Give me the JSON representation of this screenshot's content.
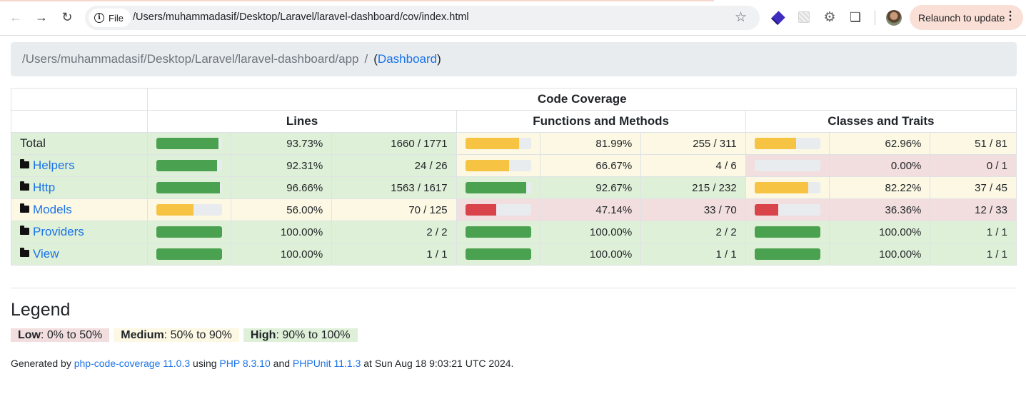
{
  "browser": {
    "chip_label": "File",
    "url": "/Users/muhammadasif/Desktop/Laravel/laravel-dashboard/cov/index.html",
    "relaunch_label": "Relaunch to update"
  },
  "breadcrumb": {
    "path": "/Users/muhammadasif/Desktop/Laravel/laravel-dashboard/app",
    "separator": "/",
    "open_paren": "(",
    "link": "Dashboard",
    "close_paren": ")"
  },
  "table": {
    "header_main": "Code Coverage",
    "headers": [
      "Lines",
      "Functions and Methods",
      "Classes and Traits"
    ],
    "rows": [
      {
        "name": "Total",
        "folder": false,
        "row_class": "success",
        "lines": {
          "pct": "93.73%",
          "ratio": "1660 / 1771",
          "value": 93.73,
          "level": "success"
        },
        "functions": {
          "pct": "81.99%",
          "ratio": "255 / 311",
          "value": 81.99,
          "level": "warning"
        },
        "classes": {
          "pct": "62.96%",
          "ratio": "51 / 81",
          "value": 62.96,
          "level": "warning"
        }
      },
      {
        "name": "Helpers",
        "folder": true,
        "row_class": "success",
        "lines": {
          "pct": "92.31%",
          "ratio": "24 / 26",
          "value": 92.31,
          "level": "success"
        },
        "functions": {
          "pct": "66.67%",
          "ratio": "4 / 6",
          "value": 66.67,
          "level": "warning"
        },
        "classes": {
          "pct": "0.00%",
          "ratio": "0 / 1",
          "value": 0,
          "level": "danger"
        }
      },
      {
        "name": "Http",
        "folder": true,
        "row_class": "success",
        "lines": {
          "pct": "96.66%",
          "ratio": "1563 / 1617",
          "value": 96.66,
          "level": "success"
        },
        "functions": {
          "pct": "92.67%",
          "ratio": "215 / 232",
          "value": 92.67,
          "level": "success"
        },
        "classes": {
          "pct": "82.22%",
          "ratio": "37 / 45",
          "value": 82.22,
          "level": "warning"
        }
      },
      {
        "name": "Models",
        "folder": true,
        "row_class": "warning",
        "lines": {
          "pct": "56.00%",
          "ratio": "70 / 125",
          "value": 56.0,
          "level": "warning"
        },
        "functions": {
          "pct": "47.14%",
          "ratio": "33 / 70",
          "value": 47.14,
          "level": "danger"
        },
        "classes": {
          "pct": "36.36%",
          "ratio": "12 / 33",
          "value": 36.36,
          "level": "danger"
        }
      },
      {
        "name": "Providers",
        "folder": true,
        "row_class": "success",
        "lines": {
          "pct": "100.00%",
          "ratio": "2 / 2",
          "value": 100,
          "level": "success"
        },
        "functions": {
          "pct": "100.00%",
          "ratio": "2 / 2",
          "value": 100,
          "level": "success"
        },
        "classes": {
          "pct": "100.00%",
          "ratio": "1 / 1",
          "value": 100,
          "level": "success"
        }
      },
      {
        "name": "View",
        "folder": true,
        "row_class": "success",
        "lines": {
          "pct": "100.00%",
          "ratio": "1 / 1",
          "value": 100,
          "level": "success"
        },
        "functions": {
          "pct": "100.00%",
          "ratio": "1 / 1",
          "value": 100,
          "level": "success"
        },
        "classes": {
          "pct": "100.00%",
          "ratio": "1 / 1",
          "value": 100,
          "level": "success"
        }
      }
    ]
  },
  "legend": {
    "title": "Legend",
    "low_label": "Low",
    "low_range": ": 0% to 50%",
    "medium_label": "Medium",
    "medium_range": ": 50% to 90%",
    "high_label": "High",
    "high_range": ": 90% to 100%"
  },
  "footer": {
    "prefix": "Generated by ",
    "tool_link": "php-code-coverage 11.0.3",
    "using": " using ",
    "php_link": "PHP 8.3.10",
    "and": " and ",
    "phpunit_link": "PHPUnit 11.1.3",
    "suffix": " at Sun Aug 18 9:03:21 UTC 2024."
  },
  "colors": {
    "success_bg": "#dff0d8",
    "warning_bg": "#fcf8e3",
    "danger_bg": "#f2dede",
    "success_bar": "#4aa150",
    "warning_bar": "#f6c342",
    "danger_bar": "#d9434a",
    "link": "#1a73e8"
  },
  "icons": {
    "back": "arrow-left-icon",
    "forward": "arrow-right-icon",
    "reload": "reload-icon",
    "info": "info-icon",
    "bookmark": "star-icon",
    "folder": "folder-icon",
    "menu": "kebab-menu-icon"
  }
}
